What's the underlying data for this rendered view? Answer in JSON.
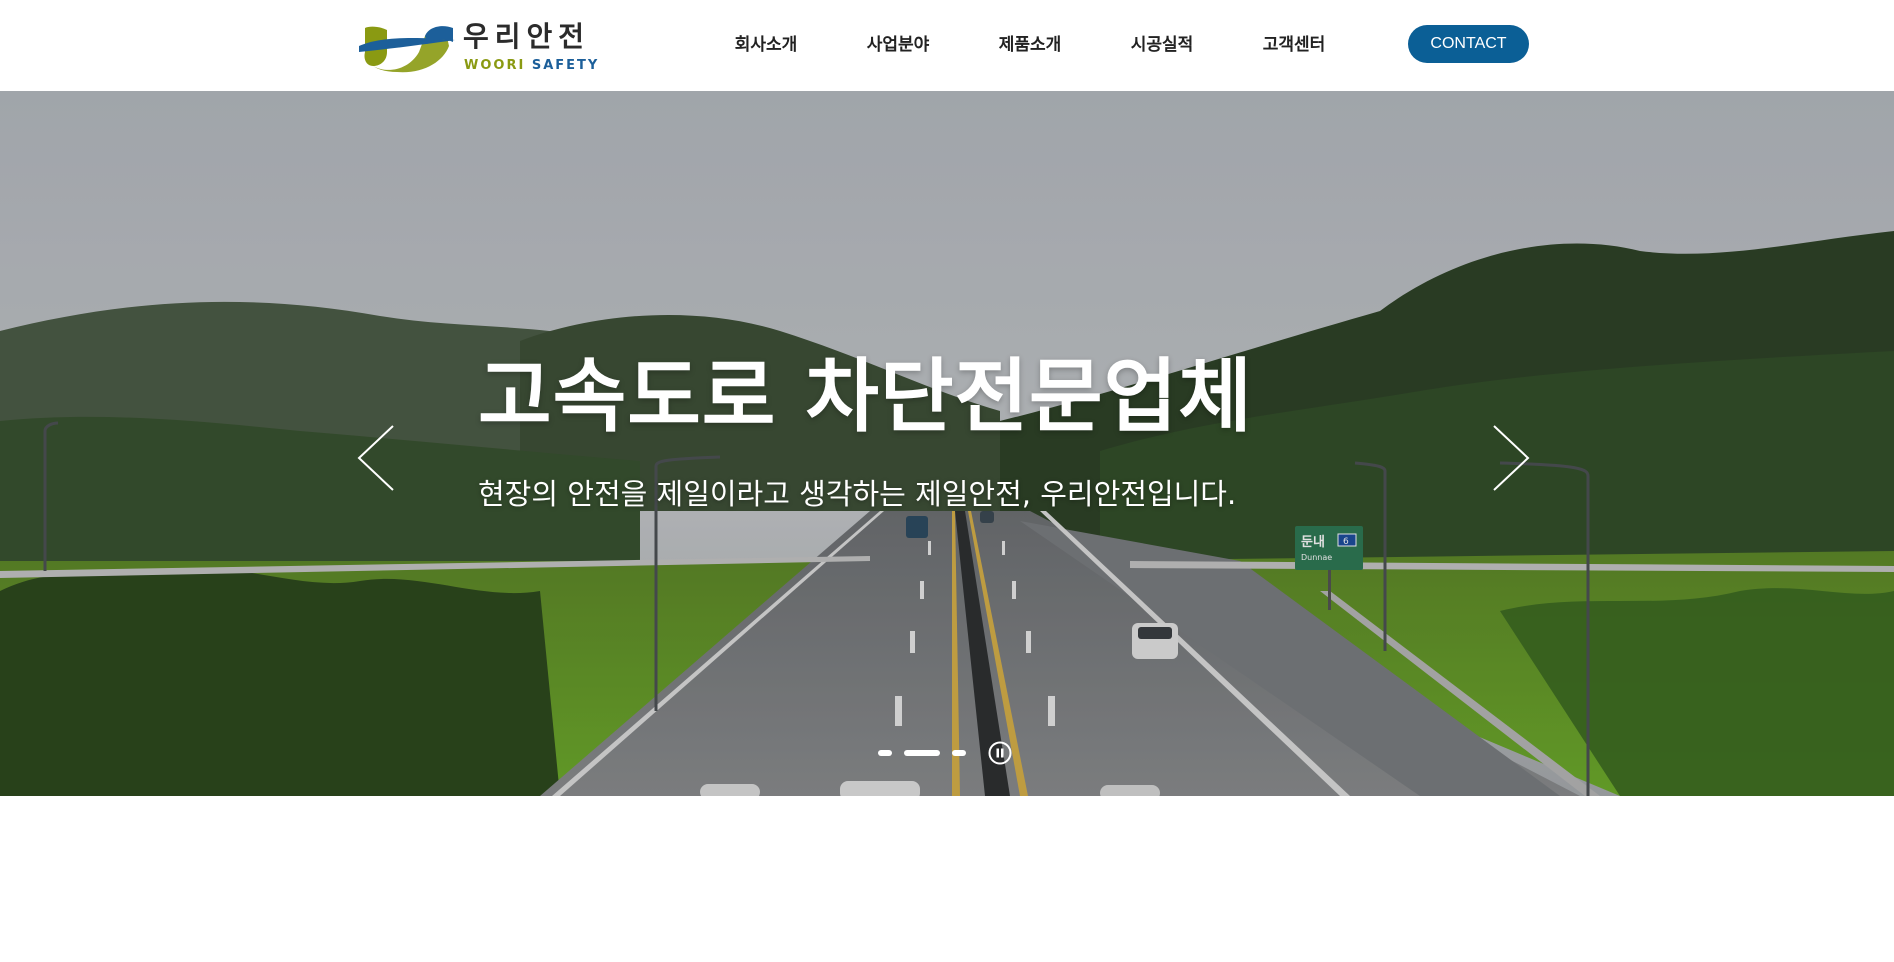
{
  "logo": {
    "name_ko": "우리안전",
    "name_en_part1": "WOORI",
    "name_en_part2": "SAFETY"
  },
  "nav": {
    "items": [
      "회사소개",
      "사업분야",
      "제품소개",
      "시공실적",
      "고객센터"
    ]
  },
  "contact_button": "CONTACT",
  "hero": {
    "title": "고속도로 차단전문업체",
    "subtitle": "현장의 안전을 제일이라고 생각하는 제일안전, 우리안전입니다.",
    "road_sign_label": "둔내",
    "road_sign_label_en": "Dunnae",
    "road_sign_number": "6",
    "slide_count": 3,
    "active_slide": 2
  },
  "colors": {
    "brand_blue": "#0b5f96",
    "brand_green": "#8a9a12",
    "text_dark": "#222222"
  },
  "icons": {
    "prev": "chevron-left-icon",
    "next": "chevron-right-icon",
    "pause": "pause-icon"
  }
}
